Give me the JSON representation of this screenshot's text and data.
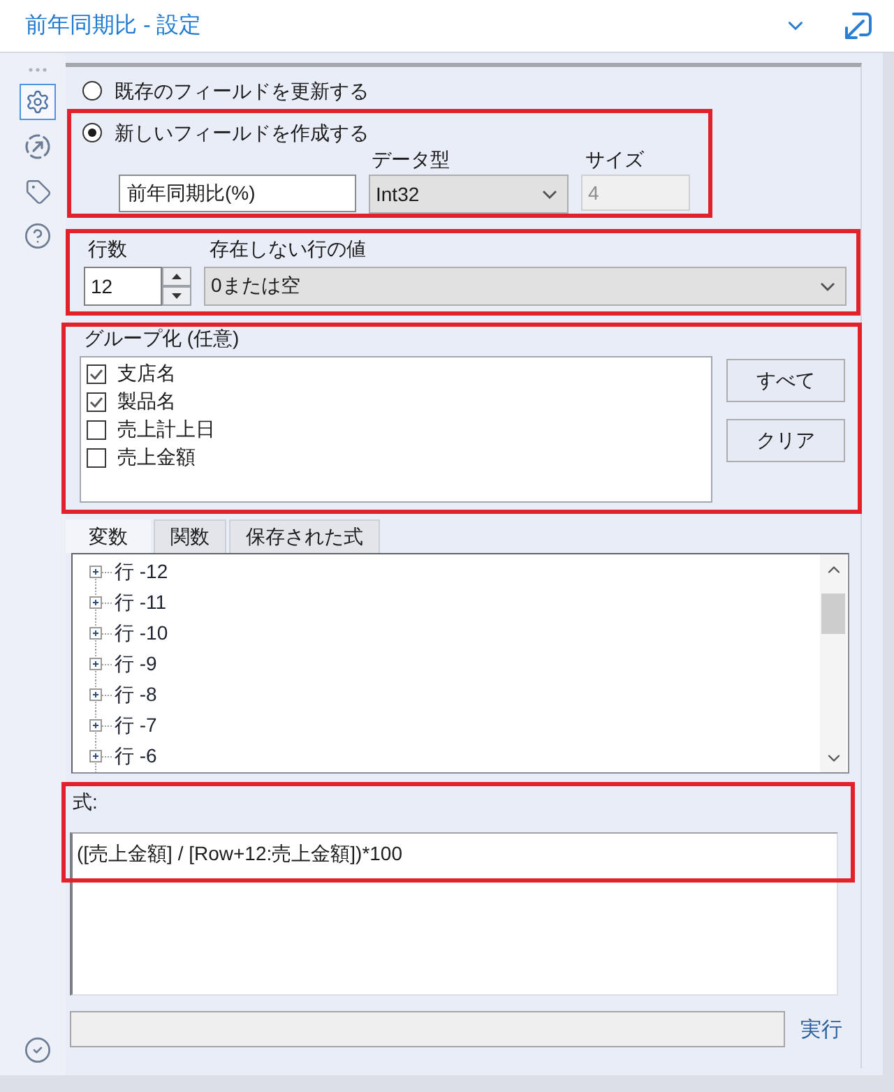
{
  "window": {
    "title": "前年同期比 - 設定"
  },
  "sidebar": {
    "items": [
      {
        "selected": true
      },
      {
        "selected": false
      },
      {
        "selected": false
      },
      {
        "selected": false
      }
    ]
  },
  "output_options": [
    {
      "label": "既存のフィールドを更新する",
      "selected": false
    },
    {
      "label": "新しいフィールドを作成する",
      "selected": true
    }
  ],
  "new_field": {
    "highlighted": true,
    "name": {
      "value": "前年同期比(%)"
    },
    "data_type": {
      "label": "データ型",
      "value": "Int32"
    },
    "size": {
      "label": "サイズ",
      "value": "4",
      "disabled": true
    }
  },
  "rows": {
    "highlighted": true,
    "row_count": {
      "label": "行数",
      "value": "12"
    },
    "missing_rows": {
      "label": "存在しない行の値",
      "value": "0または空"
    }
  },
  "grouping": {
    "highlighted": true,
    "label": "グループ化 (任意)",
    "items": [
      {
        "label": "支店名",
        "checked": true
      },
      {
        "label": "製品名",
        "checked": true
      },
      {
        "label": "売上計上日",
        "checked": false
      },
      {
        "label": "売上金額",
        "checked": false
      }
    ],
    "buttons": [
      "すべて",
      "クリア"
    ]
  },
  "tabs": [
    {
      "label": "変数",
      "selected": true
    },
    {
      "label": "関数",
      "selected": false
    },
    {
      "label": "保存された式",
      "selected": false
    }
  ],
  "variables": {
    "items": [
      {
        "label": "行 -12",
        "expanded": false
      },
      {
        "label": "行 -11",
        "expanded": false
      },
      {
        "label": "行 -10",
        "expanded": false
      },
      {
        "label": "行 -9",
        "expanded": false
      },
      {
        "label": "行 -8",
        "expanded": false
      },
      {
        "label": "行 -7",
        "expanded": false
      },
      {
        "label": "行 -6",
        "expanded": false
      }
    ]
  },
  "expression": {
    "highlighted": true,
    "label": "式:",
    "value": "([売上金額] / [Row+12:売上金額])*100"
  },
  "footer": {
    "run_link": "実行"
  }
}
